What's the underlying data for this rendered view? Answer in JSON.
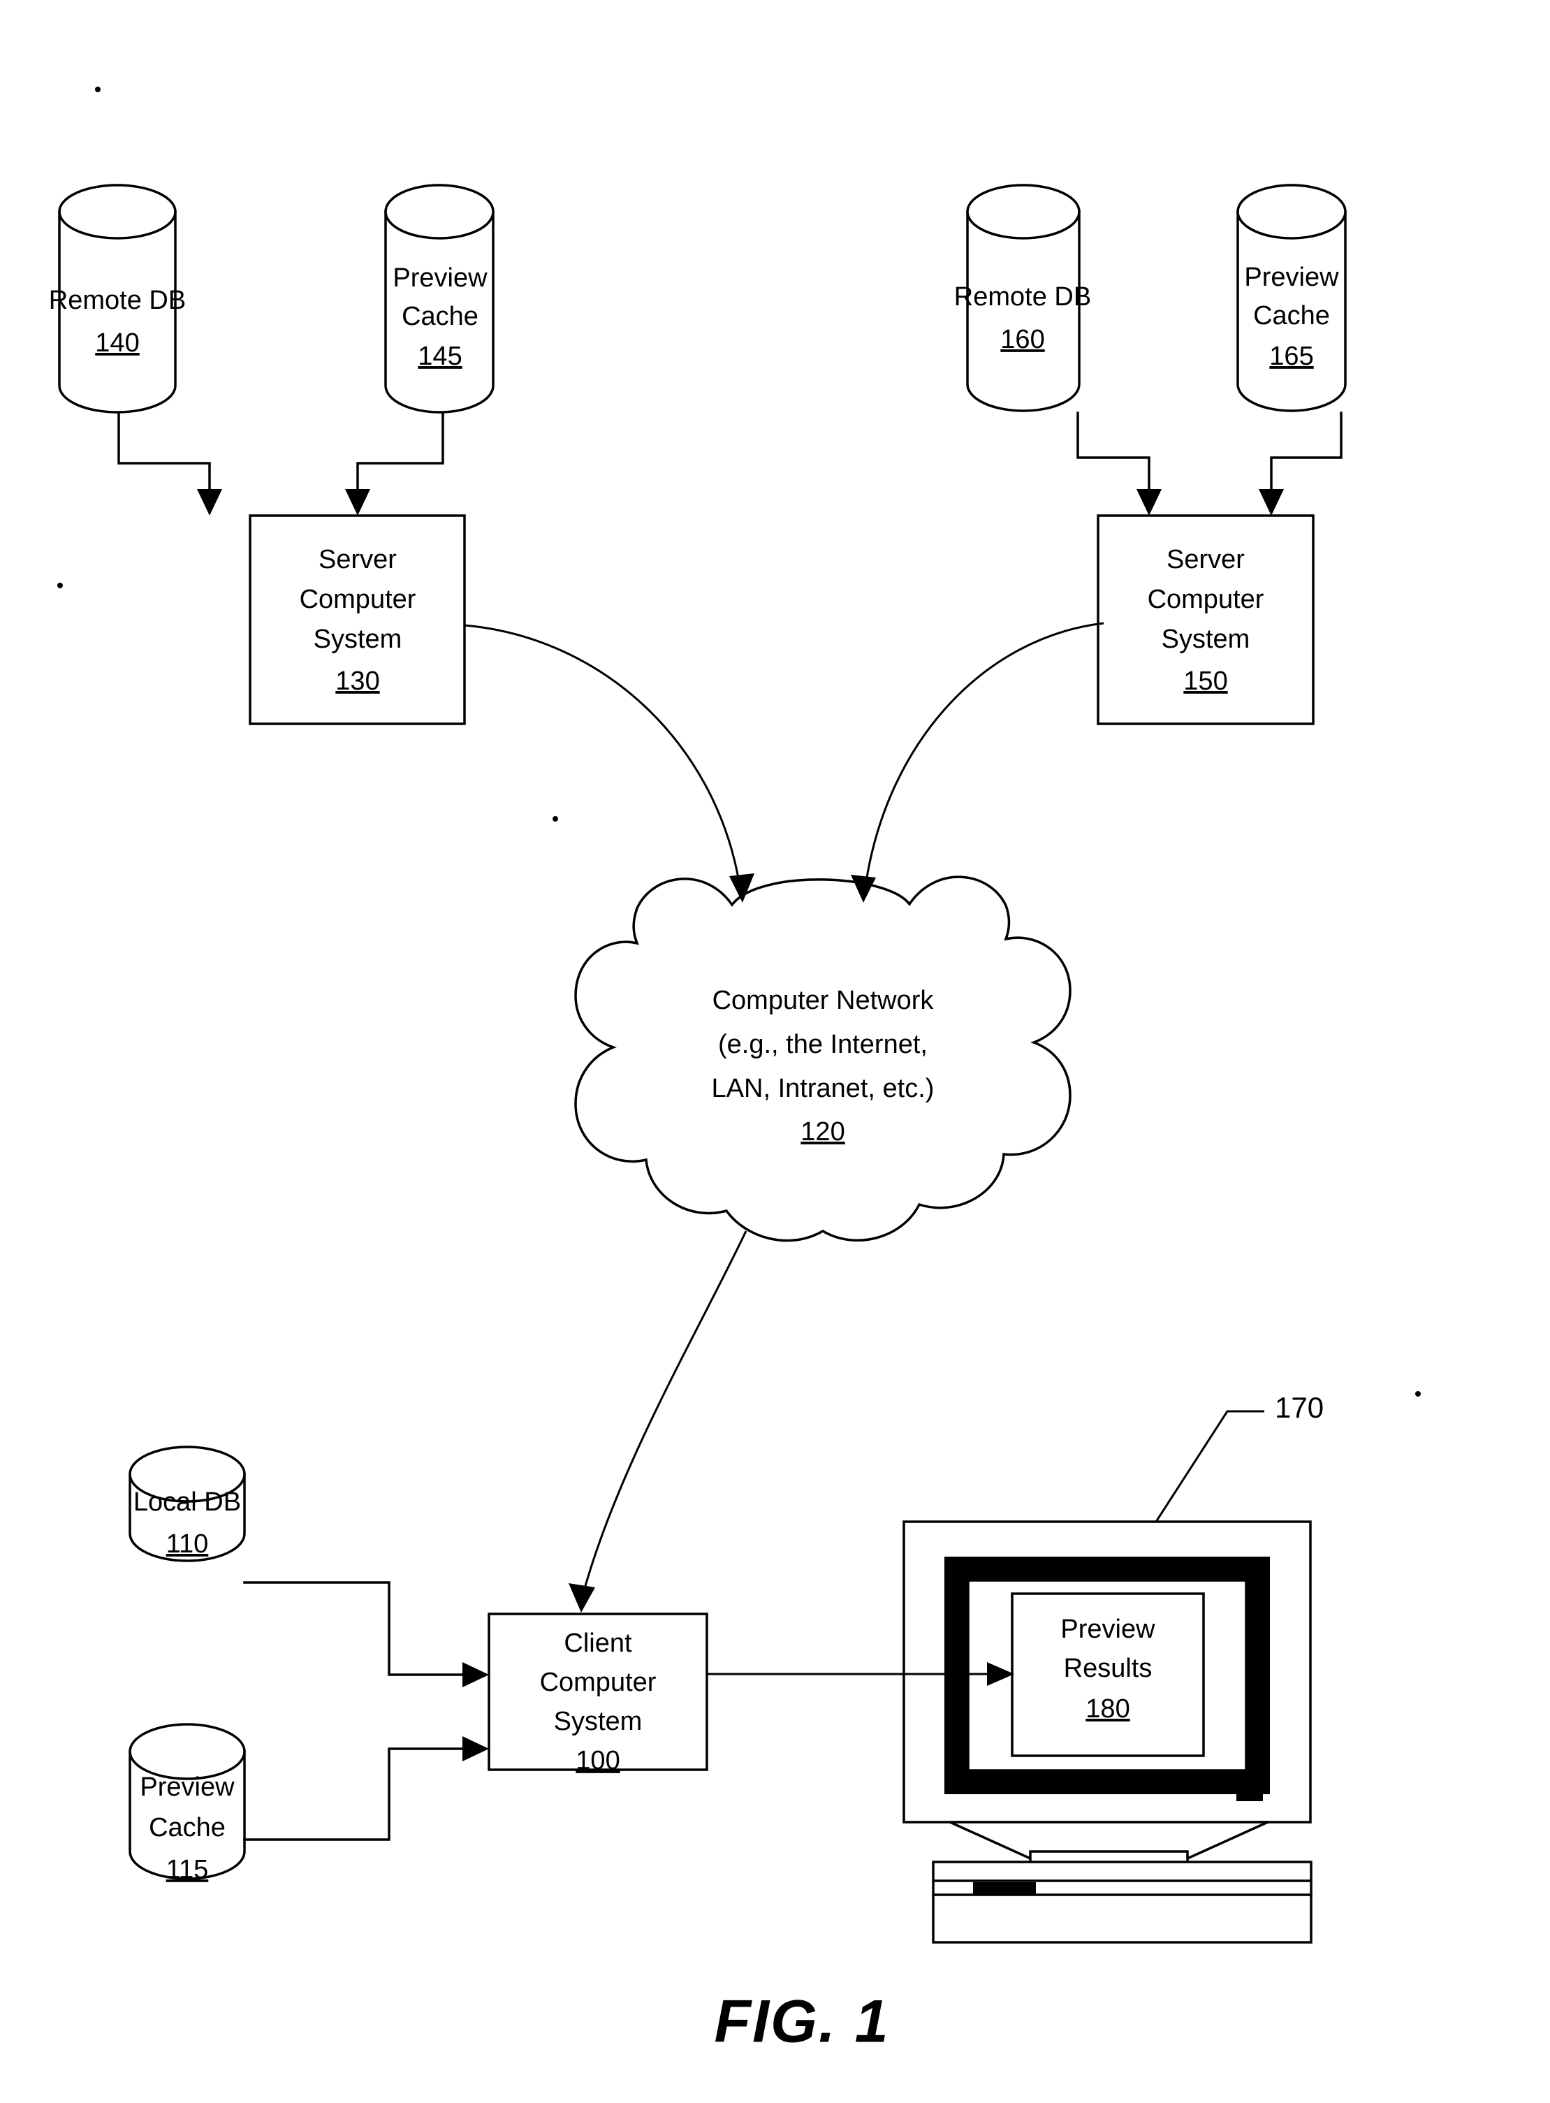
{
  "figure": {
    "caption": "FIG. 1",
    "background_color": "#ffffff",
    "line_color": "#000000"
  },
  "nodes": {
    "remote_db_140": {
      "shape": "cylinder",
      "label_line1": "Remote DB",
      "ref": "140"
    },
    "preview_cache_145": {
      "shape": "cylinder",
      "label_line1": "Preview",
      "label_line2": "Cache",
      "ref": "145"
    },
    "server_130": {
      "shape": "rectangle",
      "label_line1": "Server",
      "label_line2": "Computer",
      "label_line3": "System",
      "ref": "130"
    },
    "remote_db_160": {
      "shape": "cylinder",
      "label_line1": "Remote DB",
      "ref": "160"
    },
    "preview_cache_165": {
      "shape": "cylinder",
      "label_line1": "Preview",
      "label_line2": "Cache",
      "ref": "165"
    },
    "server_150": {
      "shape": "rectangle",
      "label_line1": "Server",
      "label_line2": "Computer",
      "label_line3": "System",
      "ref": "150"
    },
    "network_120": {
      "shape": "cloud",
      "label_line1": "Computer Network",
      "label_line2": "(e.g., the Internet,",
      "label_line3": "LAN, Intranet, etc.)",
      "ref": "120"
    },
    "local_db_110": {
      "shape": "cylinder",
      "label_line1": "Local DB",
      "ref": "110"
    },
    "preview_cache_115": {
      "shape": "cylinder",
      "label_line1": "Preview",
      "label_line2": "Cache",
      "ref": "115"
    },
    "client_100": {
      "shape": "rectangle",
      "label_line1": "Client",
      "label_line2": "Computer",
      "label_line3": "System",
      "ref": "100"
    },
    "monitor_170": {
      "shape": "crt-monitor",
      "ref": "170"
    },
    "preview_results_180": {
      "shape": "rectangle",
      "label_line1": "Preview",
      "label_line2": "Results",
      "ref": "180"
    }
  }
}
